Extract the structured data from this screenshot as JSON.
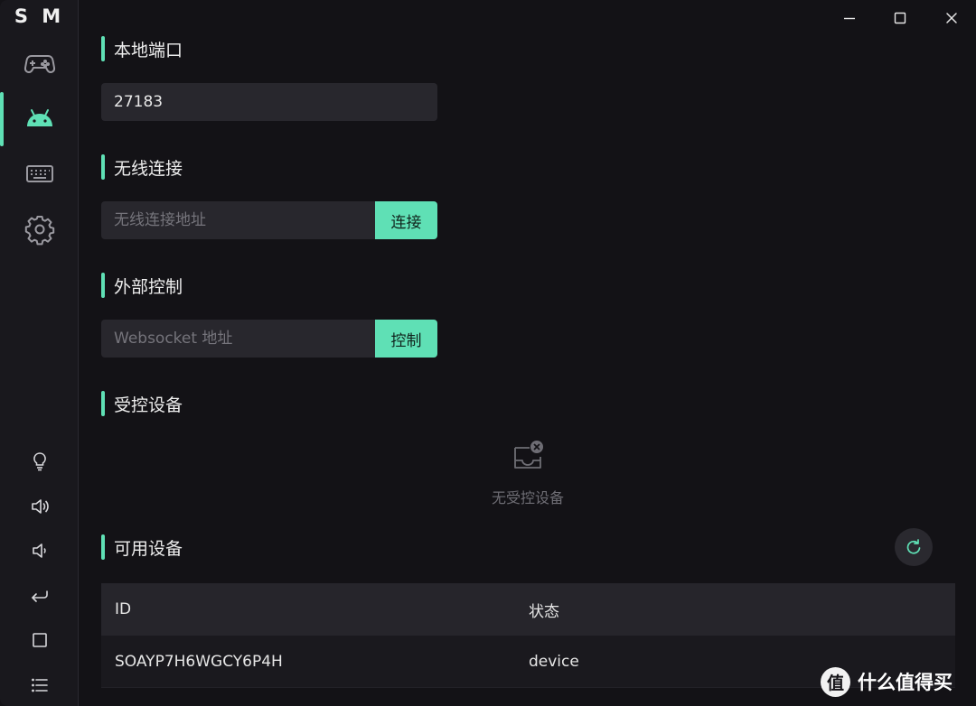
{
  "app": {
    "brand": "S M"
  },
  "sidebar": {
    "nav": [
      {
        "icon": "gamepad-icon",
        "active": false
      },
      {
        "icon": "android-icon",
        "active": true
      },
      {
        "icon": "keyboard-icon",
        "active": false
      },
      {
        "icon": "settings-gear-icon",
        "active": false
      }
    ],
    "tools": [
      {
        "icon": "lightbulb-icon"
      },
      {
        "icon": "volume-up-icon"
      },
      {
        "icon": "volume-down-icon"
      },
      {
        "icon": "back-arrow-icon"
      },
      {
        "icon": "home-square-icon"
      },
      {
        "icon": "menu-list-icon"
      }
    ]
  },
  "window_controls": [
    "minimize-icon",
    "maximize-icon",
    "close-icon"
  ],
  "local_port": {
    "title": "本地端口",
    "value": "27183"
  },
  "wireless": {
    "title": "无线连接",
    "placeholder": "无线连接地址",
    "button": "连接"
  },
  "external": {
    "title": "外部控制",
    "placeholder": "Websocket 地址",
    "button": "控制"
  },
  "controlled": {
    "title": "受控设备",
    "empty_text": "无受控设备"
  },
  "available": {
    "title": "可用设备",
    "columns": [
      "ID",
      "状态"
    ],
    "rows": [
      {
        "id": "SOAYP7H6WGCY6P4H",
        "status": "device"
      }
    ]
  },
  "watermark": {
    "logo": "值",
    "text": "什么值得买"
  },
  "colors": {
    "accent": "#5fe0b5",
    "background": "#131216",
    "sidebar": "#19181d",
    "input": "#28272d"
  }
}
